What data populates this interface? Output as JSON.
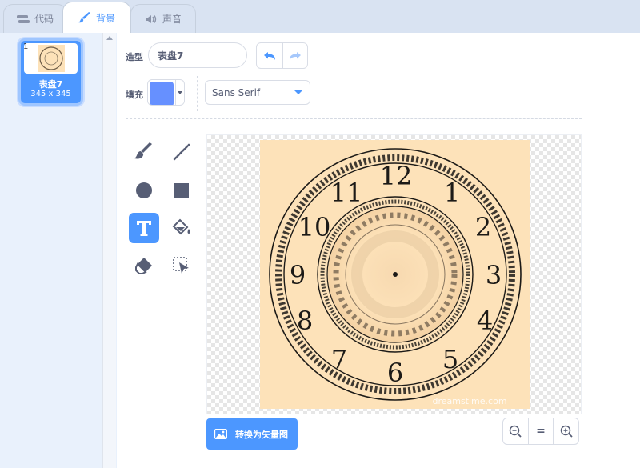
{
  "tabs": [
    {
      "label": "代码",
      "icon": "code-blocks-icon"
    },
    {
      "label": "背景",
      "icon": "brush-icon",
      "active": true
    },
    {
      "label": "声音",
      "icon": "speaker-icon"
    }
  ],
  "costumes": [
    {
      "index": "1",
      "name": "表盘7",
      "size": "345 x 345",
      "selected": true
    }
  ],
  "editor": {
    "costume_label": "造型",
    "costume_name": "表盘7",
    "fill_label": "填充",
    "fill_color": "#6690ff",
    "font": "Sans Serif",
    "convert_button": "转换为矢量图",
    "zoom_reset": "="
  },
  "tools": [
    "brush-icon",
    "line-icon",
    "circle-icon",
    "rectangle-icon",
    "text-icon",
    "fill-icon",
    "eraser-icon",
    "select-icon"
  ],
  "active_tool": "text-icon",
  "clock": {
    "numerals": [
      "12",
      "1",
      "2",
      "3",
      "4",
      "5",
      "6",
      "7",
      "8",
      "9",
      "10",
      "11"
    ],
    "watermark": "dreamstime.com"
  },
  "colors": {
    "accent": "#4c97ff",
    "canvas_bg": "#fde2b9"
  }
}
